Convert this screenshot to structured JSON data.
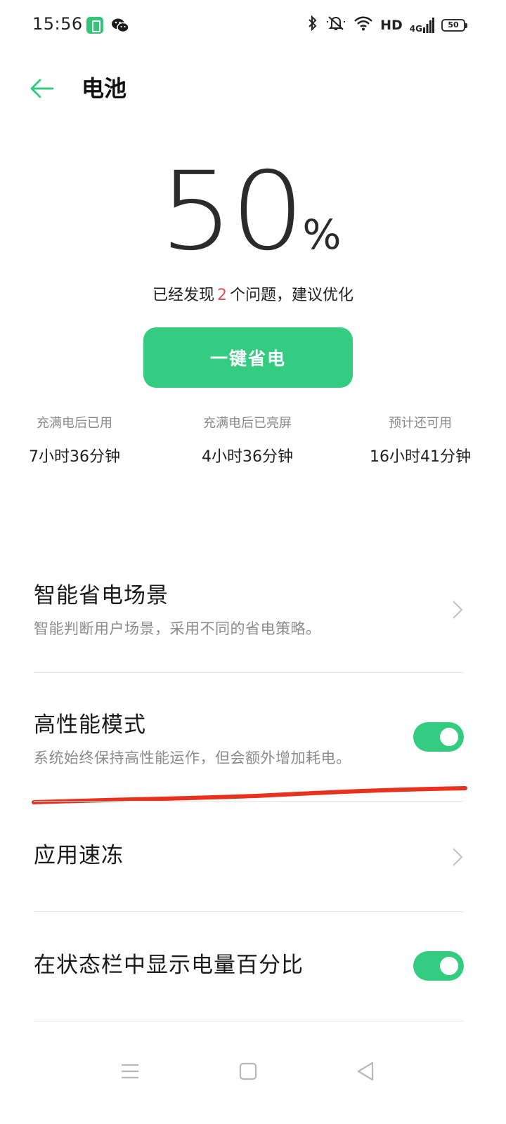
{
  "status_bar": {
    "time": "15:56",
    "hd_label": "HD",
    "network_label": "4G",
    "battery_level": "50"
  },
  "header": {
    "title": "电池"
  },
  "battery": {
    "percent": "50",
    "percent_sign": "%",
    "issue_prefix": "已经发现",
    "issue_count": "2",
    "issue_suffix": "个问题，建议优化",
    "save_button_label": "一键省电"
  },
  "stats": [
    {
      "label": "充满电后已用",
      "value": "7小时36分钟"
    },
    {
      "label": "充满电后已亮屏",
      "value": "4小时36分钟"
    },
    {
      "label": "预计还可用",
      "value": "16小时41分钟"
    }
  ],
  "settings": {
    "smart_scene": {
      "title": "智能省电场景",
      "desc": "智能判断用户场景，采用不同的省电策略。"
    },
    "performance_mode": {
      "title": "高性能模式",
      "desc": "系统始终保持高性能运作，但会额外增加耗电。",
      "enabled": true
    },
    "app_freeze": {
      "title": "应用速冻"
    },
    "show_percent": {
      "title": "在状态栏中显示电量百分比",
      "enabled": true
    }
  },
  "colors": {
    "accent": "#33cc80",
    "issue": "#e0505b",
    "annotation": "#e8321e"
  },
  "icons": {
    "back": "arrow-left-icon",
    "chevron": "chevron-right-icon",
    "nav_menu": "menu-icon",
    "nav_home": "home-square-icon",
    "nav_back": "back-triangle-icon"
  }
}
